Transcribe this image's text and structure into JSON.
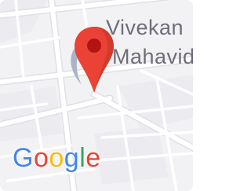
{
  "map": {
    "place_label_line1": "Vivekan",
    "place_label_line2": "Mahavid",
    "logo_text": "Google",
    "logo_letters": [
      "G",
      "o",
      "o",
      "g",
      "l",
      "e"
    ],
    "colors": {
      "background": "#f5f5f7",
      "road": "#ffffff",
      "road_outline": "#dcdde3",
      "block": "#eeeef2",
      "pin_red": "#ea4335",
      "pin_dark": "#b31412",
      "logo_blue": "#4285f4",
      "logo_red": "#ea4335",
      "logo_yellow": "#fbbc05",
      "logo_green": "#34a853"
    }
  }
}
